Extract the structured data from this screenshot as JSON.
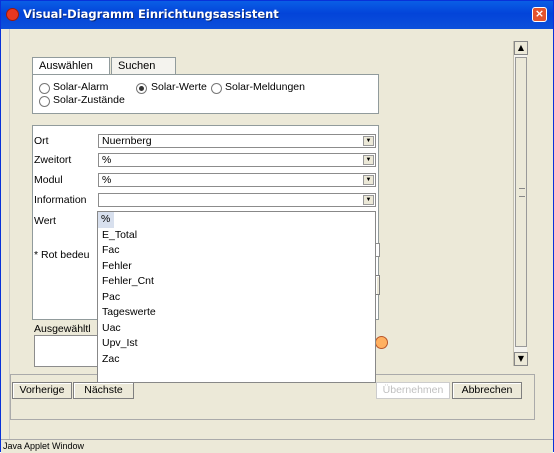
{
  "window": {
    "title": "Visual-Diagramm Einrichtungsassistent",
    "app_icon": "java-applet-icon",
    "close_icon": "close-icon"
  },
  "tabs": [
    {
      "label": "Auswählen",
      "active": true
    },
    {
      "label": "Suchen",
      "active": false
    }
  ],
  "radio_group": {
    "options": [
      {
        "label": "Solar-Alarm",
        "checked": false
      },
      {
        "label": "Solar-Werte",
        "checked": true
      },
      {
        "label": "Solar-Meldungen",
        "checked": false
      },
      {
        "label": "Solar-Zustände",
        "checked": false
      }
    ]
  },
  "form": {
    "fields": [
      {
        "label": "Ort",
        "value": "Nuernberg"
      },
      {
        "label": "Zweitort",
        "value": "%"
      },
      {
        "label": "Modul",
        "value": "%"
      },
      {
        "label": "Information",
        "value": ""
      }
    ],
    "wert_label": "Wert",
    "note_label": "* Rot bedeu",
    "selected_label": "Ausgewähltl"
  },
  "dropdown": {
    "items": [
      "%",
      "E_Total",
      "Fac",
      "Fehler",
      "Fehler_Cnt",
      "Pac",
      "Tageswerte",
      "Uac",
      "Upv_Ist",
      "Zac"
    ],
    "highlighted_index": 0
  },
  "buttons": {
    "previous": "Vorherige",
    "next": "Nächste",
    "apply": "Übernehmen",
    "cancel": "Abbrechen"
  },
  "status_bar": {
    "text": "Java Applet Window"
  },
  "colors": {
    "titlebar": "#0a5ee6",
    "close_button": "#e3532c",
    "dropdown_highlight": "#d8e0ee"
  }
}
